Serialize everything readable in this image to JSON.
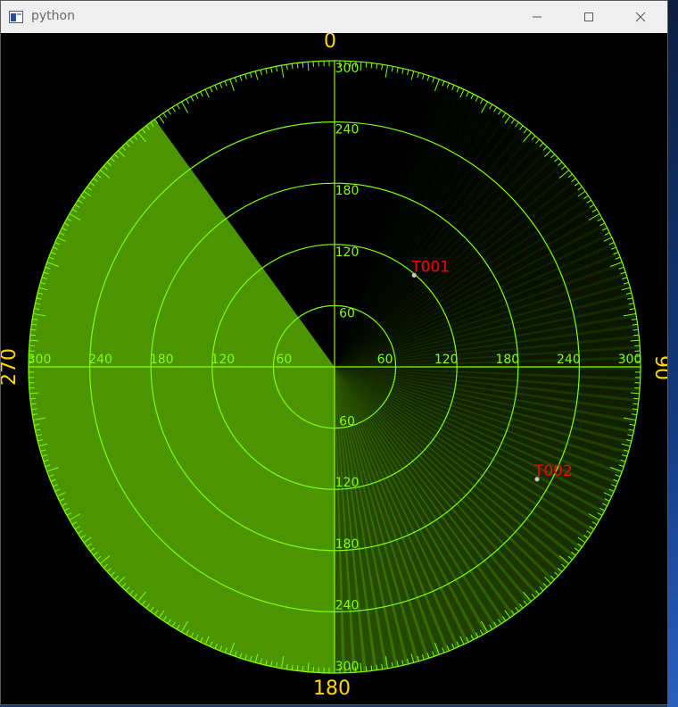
{
  "window": {
    "title": "python",
    "icon": "python-app-icon",
    "buttons": {
      "minimize": "minimize-icon",
      "maximize": "maximize-icon",
      "close": "close-icon"
    }
  },
  "radar": {
    "bearing_labels": [
      "0",
      "90",
      "180",
      "270"
    ],
    "range_labels": [
      "60",
      "120",
      "180",
      "240",
      "300"
    ],
    "max_range": 300,
    "ring_step": 60,
    "sweep": {
      "start_bearing_deg": 180,
      "end_bearing_deg": 324,
      "history_trail_deg": 180
    },
    "targets": [
      {
        "id": "T001",
        "bearing_deg": 41,
        "range": 119
      },
      {
        "id": "T002",
        "bearing_deg": 119,
        "range": 227
      }
    ],
    "colors": {
      "background": "#000000",
      "grid": "#7fff00",
      "sweep": "#4b9600",
      "bearing_label": "#ffd700",
      "target_label": "#ff0000",
      "target_dot": "#c8c8c8"
    }
  }
}
